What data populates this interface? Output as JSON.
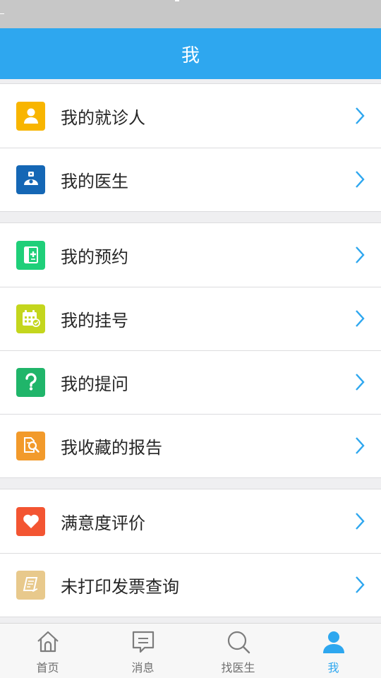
{
  "header": {
    "title": "我"
  },
  "groups": [
    {
      "items": [
        {
          "label": "我的就诊人",
          "icon": "patient-icon",
          "color": "#f8b500"
        },
        {
          "label": "我的医生",
          "icon": "doctor-icon",
          "color": "#1567b5"
        }
      ]
    },
    {
      "items": [
        {
          "label": "我的预约",
          "icon": "appointment-icon",
          "color": "#1fcf79"
        },
        {
          "label": "我的挂号",
          "icon": "calendar-check-icon",
          "color": "#c4d61d"
        },
        {
          "label": "我的提问",
          "icon": "question-icon",
          "color": "#20b56a"
        },
        {
          "label": "我收藏的报告",
          "icon": "report-search-icon",
          "color": "#f29a2b"
        }
      ]
    },
    {
      "items": [
        {
          "label": "满意度评价",
          "icon": "heart-icon",
          "color": "#f35532"
        },
        {
          "label": "未打印发票查询",
          "icon": "invoice-icon",
          "color": "#e8c98c"
        }
      ]
    }
  ],
  "tabs": [
    {
      "label": "首页",
      "icon": "home-icon",
      "active": false
    },
    {
      "label": "消息",
      "icon": "message-icon",
      "active": false
    },
    {
      "label": "找医生",
      "icon": "search-icon",
      "active": false
    },
    {
      "label": "我",
      "icon": "person-icon",
      "active": true
    }
  ],
  "colors": {
    "accent": "#2ea7ef",
    "statusbar": "#c7c7c7",
    "text": "#262626",
    "tab_inactive": "#6f6f6f"
  }
}
